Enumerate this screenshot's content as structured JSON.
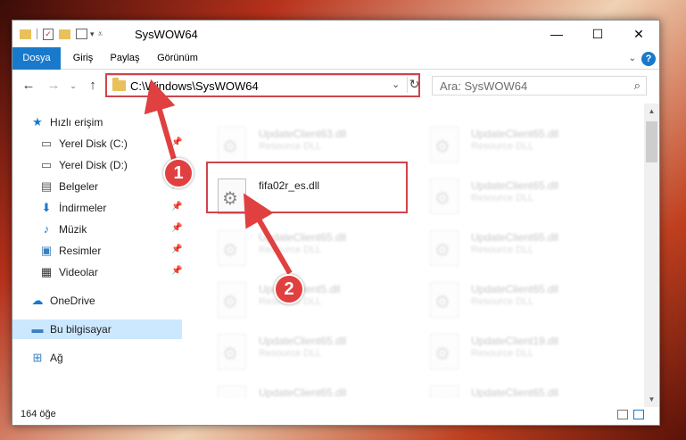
{
  "window": {
    "title": "SysWOW64",
    "minimize": "—",
    "maximize": "☐",
    "close": "✕"
  },
  "ribbon": {
    "tabs": [
      "Dosya",
      "Giriş",
      "Paylaş",
      "Görünüm"
    ],
    "help": "?"
  },
  "address": {
    "path": "C:\\Windows\\SysWOW64",
    "back": "←",
    "forward": "→",
    "up": "↑",
    "dropdown": "⌄",
    "refresh": "↻"
  },
  "search": {
    "placeholder": "Ara: SysWOW64",
    "icon": "search-icon"
  },
  "nav": {
    "items": [
      {
        "label": "Hızlı erişim",
        "icon": "star-icon",
        "glyph": "★",
        "color": "#1979ca"
      },
      {
        "label": "Yerel Disk (C:)",
        "icon": "drive-icon",
        "glyph": "▭",
        "color": "#555555",
        "pin": "📌"
      },
      {
        "label": "Yerel Disk (D:)",
        "icon": "drive-icon",
        "glyph": "▭",
        "color": "#555555",
        "pin": "📌"
      },
      {
        "label": "Belgeler",
        "icon": "document-icon",
        "glyph": "▤",
        "color": "#555555",
        "pin": "📌"
      },
      {
        "label": "İndirmeler",
        "icon": "download-icon",
        "glyph": "⬇",
        "color": "#1979ca",
        "pin": "📌"
      },
      {
        "label": "Müzik",
        "icon": "music-icon",
        "glyph": "♪",
        "color": "#1979ca",
        "pin": "📌"
      },
      {
        "label": "Resimler",
        "icon": "pictures-icon",
        "glyph": "▣",
        "color": "#3a7fc0",
        "pin": "📌"
      },
      {
        "label": "Videolar",
        "icon": "video-icon",
        "glyph": "▦",
        "color": "#333333",
        "pin": "📌"
      },
      {
        "label": "OneDrive",
        "icon": "cloud-icon",
        "glyph": "☁",
        "color": "#1979ca"
      },
      {
        "label": "Bu bilgisayar",
        "icon": "computer-icon",
        "glyph": "▬",
        "color": "#3a7fc0"
      },
      {
        "label": "Ağ",
        "icon": "network-icon",
        "glyph": "⊞",
        "color": "#3a7fc0"
      }
    ]
  },
  "files": [
    {
      "name": "UpdateClient63.dll",
      "type": "Resource DLL"
    },
    {
      "name": "UpdateClient65.dll",
      "type": "Resource DLL"
    },
    {
      "name": "fifa02r_es.dll",
      "type": ""
    },
    {
      "name": "UpdateClient65.dll",
      "type": "Resource DLL"
    },
    {
      "name": "UpdateClient65.dll",
      "type": "Resource DLL"
    },
    {
      "name": "UpdateClient65.dll",
      "type": "Resource DLL"
    },
    {
      "name": "UpdateClient5.dll",
      "type": "Resource DLL"
    },
    {
      "name": "UpdateClient65.dll",
      "type": "Resource DLL"
    },
    {
      "name": "UpdateClient65.dll",
      "type": "Resource DLL"
    },
    {
      "name": "UpdateClient19.dll",
      "type": "Resource DLL"
    },
    {
      "name": "UpdateClient65.dll",
      "type": "Resource DLL"
    },
    {
      "name": "UpdateClient65.dll",
      "type": "Resource DLL"
    }
  ],
  "status": {
    "count": "164 öğe"
  },
  "annotations": {
    "step1": "1",
    "step2": "2"
  },
  "colors": {
    "accent": "#1979ca",
    "highlight": "#d0444a"
  }
}
